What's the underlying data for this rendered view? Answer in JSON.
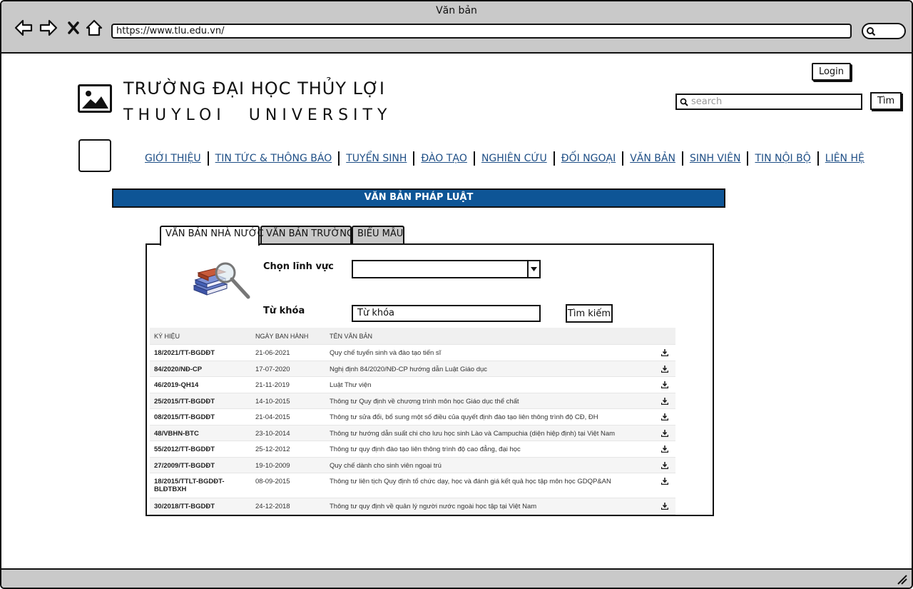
{
  "window": {
    "title": "Văn bản"
  },
  "browser": {
    "url": "https://www.tlu.edu.vn/",
    "icons": [
      "back-arrow-icon",
      "forward-arrow-icon",
      "close-x-icon",
      "home-icon",
      "search-icon"
    ]
  },
  "header": {
    "name_vn": "TRƯỜNG ĐẠI HỌC THỦY LỢI",
    "name_en": "THUYLOI UNIVERSITY",
    "login_label": "Login",
    "search_placeholder": "search",
    "search_button": "Tìm"
  },
  "menu": {
    "items": [
      "GIỚI THIỆU",
      "TIN TỨC & THÔNG BÁO",
      "TUYỂN SINH",
      "ĐÀO TẠO",
      "NGHIÊN CỨU",
      "ĐỐI NGOẠI",
      "VĂN BẢN",
      "SINH VIÊN",
      "TIN NỘI BỘ",
      "LIÊN HỆ"
    ]
  },
  "banner": {
    "title": "VĂN BẢN PHÁP LUẬT"
  },
  "tabs": [
    {
      "label": "VĂN BẢN NHÀ NƯỚC",
      "active": true
    },
    {
      "label": "VĂN BẢN TRƯỜNG",
      "active": false
    },
    {
      "label": "BIỂU MẪU",
      "active": false
    }
  ],
  "filter": {
    "field_label": "Chọn lĩnh vực",
    "field_value": "",
    "keyword_label": "Từ khóa",
    "keyword_value": "Từ khóa",
    "search_button": "Tìm kiếm"
  },
  "table": {
    "headers": [
      "KÝ HIỆU",
      "NGÀY BAN HÀNH",
      "TÊN VĂN BẢN"
    ],
    "rows": [
      {
        "code": "18/2021/TT-BGDĐT",
        "date": "21-06-2021",
        "name": "Quy chế tuyển sinh và đào tạo tiến sĩ"
      },
      {
        "code": "84/2020/NĐ-CP",
        "date": "17-07-2020",
        "name": "Nghị định 84/2020/NĐ-CP hướng dẫn Luật Giáo dục"
      },
      {
        "code": "46/2019-QH14",
        "date": "21-11-2019",
        "name": "Luật Thư viện"
      },
      {
        "code": "25/2015/TT-BGDĐT",
        "date": "14-10-2015",
        "name": "Thông tư Quy định về chương trình môn học Giáo dục thể chất"
      },
      {
        "code": "08/2015/TT-BGDĐT",
        "date": "21-04-2015",
        "name": "Thông tư sửa đổi, bổ sung một số điều của quyết định đào tạo liên thông trình độ CĐ, ĐH"
      },
      {
        "code": "48/VBHN-BTC",
        "date": "23-10-2014",
        "name": "Thông tư hướng dẫn suất chi cho lưu học sinh Lào và Campuchia (diện hiệp định) tại Việt Nam"
      },
      {
        "code": "55/2012/TT-BGDĐT",
        "date": "25-12-2012",
        "name": "Thông tư quy định đào tạo liên thông trình độ cao đẳng, đại học"
      },
      {
        "code": "27/2009/TT-BGDĐT",
        "date": "19-10-2009",
        "name": "Quy chế dành cho sinh viên ngoại trú"
      },
      {
        "code": "18/2015/TTLT-BGDĐT-BLĐTBXH",
        "date": "08-09-2015",
        "name": "Thông tư liên tịch Quy định tổ chức dạy, học và đánh giá kết quả học tập môn học GDQP&AN"
      },
      {
        "code": "30/2018/TT-BGDĐT",
        "date": "24-12-2018",
        "name": "Thông tư quy định về quản lý người nước ngoài học tập tại Việt Nam"
      }
    ]
  }
}
